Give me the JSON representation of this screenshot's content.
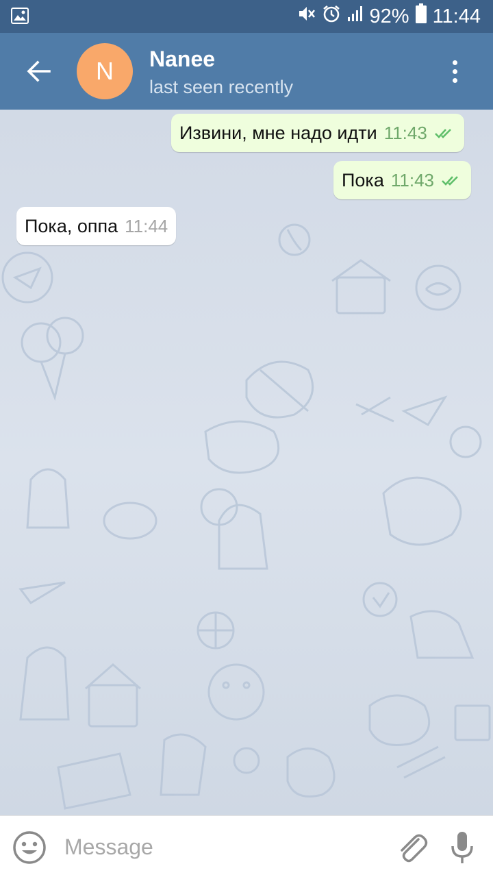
{
  "status_bar": {
    "battery": "92%",
    "time": "11:44",
    "icons": [
      "image-icon",
      "mute-icon",
      "alarm-icon",
      "signal-icon",
      "battery-icon"
    ]
  },
  "header": {
    "avatar_letter": "N",
    "avatar_color": "#f9a86a",
    "name": "Nanee",
    "status": "last seen recently",
    "back_icon": "back-arrow-icon",
    "menu_icon": "more-vert-icon"
  },
  "messages": [
    {
      "direction": "out",
      "text": "Извини, мне надо идти",
      "time": "11:43",
      "read": true
    },
    {
      "direction": "out",
      "text": "Пока",
      "time": "11:43",
      "read": true
    },
    {
      "direction": "in",
      "text": "Пока, оппа",
      "time": "11:44"
    }
  ],
  "composer": {
    "placeholder": "Message",
    "value": "",
    "emoji_icon": "emoji-icon",
    "attach_icon": "paperclip-icon",
    "mic_icon": "microphone-icon"
  },
  "colors": {
    "status_bar": "#3d6189",
    "header": "#507ca8",
    "outgoing_bubble": "#effedd",
    "incoming_bubble": "#ffffff",
    "read_ticks": "#5fbf6a"
  }
}
